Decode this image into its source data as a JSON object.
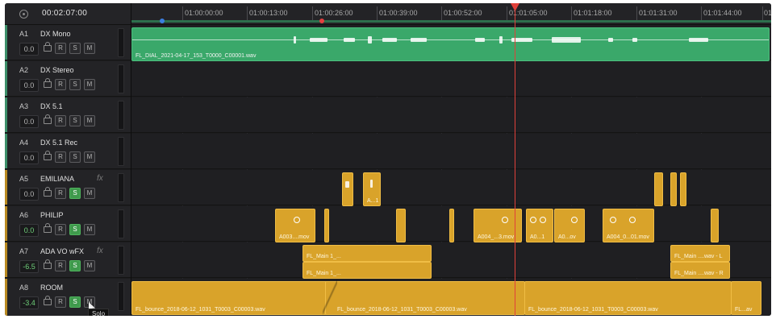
{
  "header": {
    "timecode": "00:02:07:00",
    "ruler_labels": [
      "01:00:00:00",
      "01:00:13:00",
      "01:00:26:00",
      "01:00:39:00",
      "01:00:52:00",
      "01:01:05:00",
      "01:01:18:00",
      "01:01:31:00",
      "01:01:44:00",
      "01"
    ]
  },
  "tracks": [
    {
      "id": "A1",
      "name": "DX Mono",
      "volume": "0.0",
      "fx": ""
    },
    {
      "id": "A2",
      "name": "DX Stereo",
      "volume": "0.0",
      "fx": ""
    },
    {
      "id": "A3",
      "name": "DX 5.1",
      "volume": "0.0",
      "fx": ""
    },
    {
      "id": "A4",
      "name": "DX 5.1 Rec",
      "volume": "0.0",
      "fx": ""
    },
    {
      "id": "A5",
      "name": "EMILIANA",
      "volume": "0.0",
      "fx": "fx"
    },
    {
      "id": "A6",
      "name": "PHILIP",
      "volume": "0.0",
      "fx": ""
    },
    {
      "id": "A7",
      "name": "ADA VO wFX",
      "volume": "-6.5",
      "fx": "fx"
    },
    {
      "id": "A8",
      "name": "ROOM",
      "volume": "-3.4",
      "fx": ""
    }
  ],
  "buttons": {
    "record": "R",
    "solo": "S",
    "mute": "M"
  },
  "clips": {
    "a1_main": "FL_DIAL_2021-04-17_153_T0000_C00001.wav",
    "a5_1": "",
    "a5_2": "A...1",
    "a6_1": "A003....mov",
    "a6_2": "A004_...3.mov",
    "a6_3": "A0...1",
    "a6_4": "A0...ov",
    "a6_5": "A004_0...01.mov",
    "a7_1": "FL_Main 1_...",
    "a7_2": "FL_Main 1_...",
    "a7_3": "FL_Main ....wav - L",
    "a7_4": "FL_Main ....wav - R",
    "a8_1": "FL_bounce_2018-06-12_1031_T0003_C00003.wav",
    "a8_2": "FL_bounce_2018-06-12_1031_T0003_C00003.wav",
    "a8_3": "FL_bounce_2018-06-12_1031_T0003_C00003.wav",
    "a8_4": "FL...av"
  },
  "tooltip": "Solo",
  "icons": {
    "timecode": "clock-icon",
    "lock": "lock-icon",
    "cursor": "cursor-icon"
  },
  "colors": {
    "dialog_clip": "#3aa86a",
    "audio_clip": "#d9a32a",
    "playhead": "#e0403a",
    "solo_active": "#3f9a4c"
  }
}
